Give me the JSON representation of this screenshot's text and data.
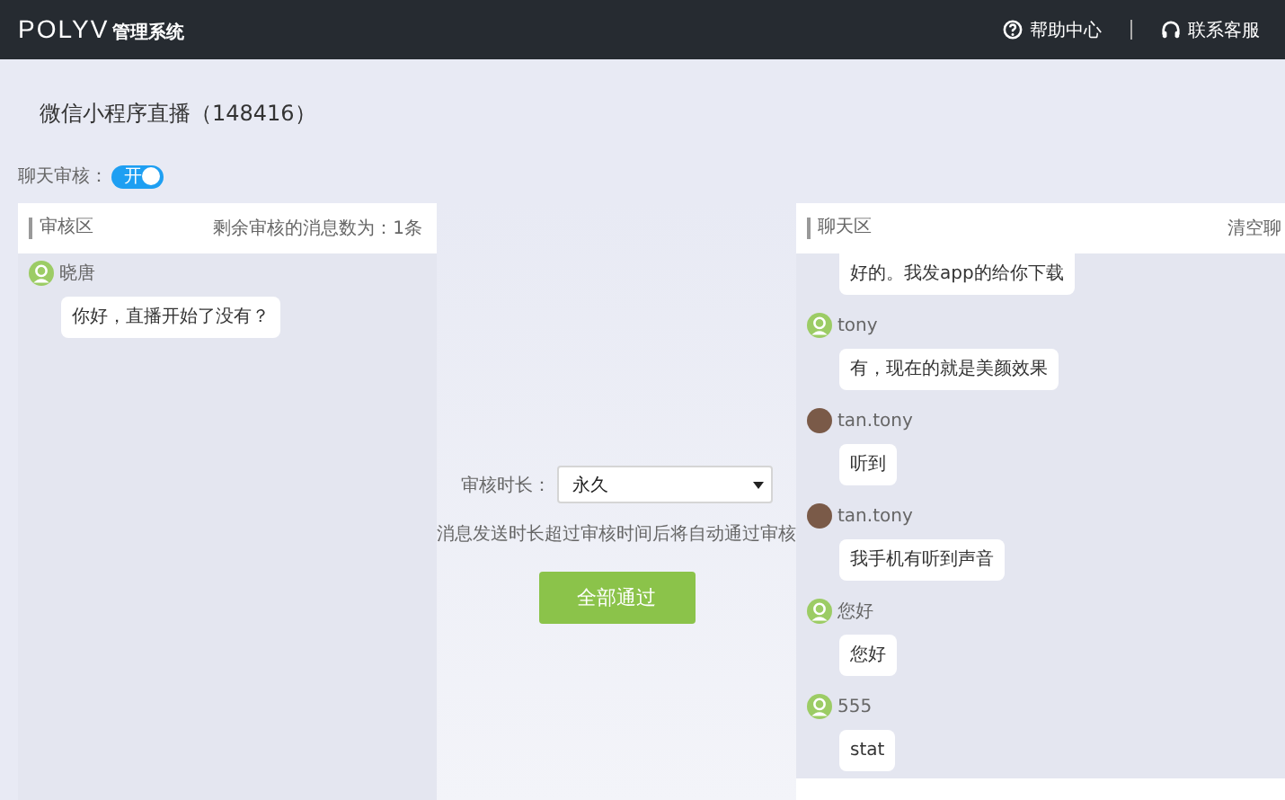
{
  "header": {
    "logo": "POLYV",
    "system_name": "管理系统",
    "links": [
      {
        "label": "帮助中心",
        "kind": "help"
      },
      {
        "label": "联系客服",
        "kind": "support"
      }
    ]
  },
  "page_title": "微信小程序直播（148416）",
  "chat_review": {
    "label": "聊天审核：",
    "on": true,
    "toggle_text": "开"
  },
  "review_panel": {
    "title": "审核区",
    "remaining": "剩余审核的消息数为：1条",
    "messages": [
      {
        "name": "晓唐",
        "photo_avatar": false,
        "text": "你好，直播开始了没有？"
      }
    ]
  },
  "review_settings": {
    "duration_label": "审核时长：",
    "duration_value": "永久",
    "hint": "消息发送时长超过审核时间后将自动通过审核",
    "approve_all": "全部通过"
  },
  "chat_panel": {
    "title": "聊天区",
    "clear": "清空聊",
    "messages": [
      {
        "text": "好的。我发app的给你下载"
      },
      {
        "name": "tony",
        "photo_avatar": false,
        "text": "有，现在的就是美颜效果"
      },
      {
        "name": "tan.tony",
        "photo_avatar": true,
        "text": "听到"
      },
      {
        "name": "tan.tony",
        "photo_avatar": true,
        "text": "我手机有听到声音"
      },
      {
        "name": "您好",
        "photo_avatar": false,
        "text": "您好"
      },
      {
        "name": "555",
        "photo_avatar": false,
        "text": "stat"
      }
    ]
  }
}
